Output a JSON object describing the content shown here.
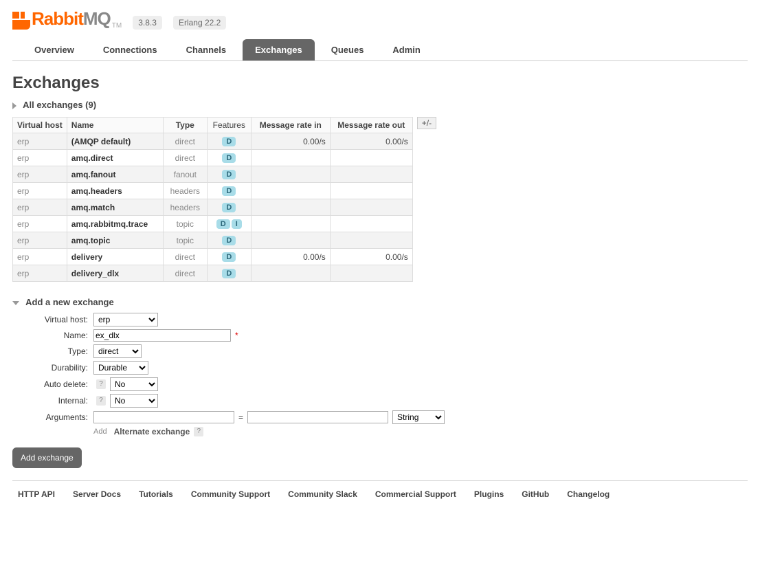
{
  "header": {
    "product_orange": "Rabbit",
    "product_grey": "MQ",
    "tm": "TM",
    "version": "3.8.3",
    "erlang": "Erlang 22.2"
  },
  "tabs": [
    "Overview",
    "Connections",
    "Channels",
    "Exchanges",
    "Queues",
    "Admin"
  ],
  "active_tab": "Exchanges",
  "page_title": "Exchanges",
  "list_section_title": "All exchanges (9)",
  "columns": {
    "vhost": "Virtual host",
    "name": "Name",
    "type": "Type",
    "features": "Features",
    "rate_in": "Message rate in",
    "rate_out": "Message rate out"
  },
  "plus_minus": "+/-",
  "rows": [
    {
      "vhost": "erp",
      "name": "(AMQP default)",
      "type": "direct",
      "features": [
        "D"
      ],
      "rate_in": "0.00/s",
      "rate_out": "0.00/s"
    },
    {
      "vhost": "erp",
      "name": "amq.direct",
      "type": "direct",
      "features": [
        "D"
      ],
      "rate_in": "",
      "rate_out": ""
    },
    {
      "vhost": "erp",
      "name": "amq.fanout",
      "type": "fanout",
      "features": [
        "D"
      ],
      "rate_in": "",
      "rate_out": ""
    },
    {
      "vhost": "erp",
      "name": "amq.headers",
      "type": "headers",
      "features": [
        "D"
      ],
      "rate_in": "",
      "rate_out": ""
    },
    {
      "vhost": "erp",
      "name": "amq.match",
      "type": "headers",
      "features": [
        "D"
      ],
      "rate_in": "",
      "rate_out": ""
    },
    {
      "vhost": "erp",
      "name": "amq.rabbitmq.trace",
      "type": "topic",
      "features": [
        "D",
        "I"
      ],
      "rate_in": "",
      "rate_out": ""
    },
    {
      "vhost": "erp",
      "name": "amq.topic",
      "type": "topic",
      "features": [
        "D"
      ],
      "rate_in": "",
      "rate_out": ""
    },
    {
      "vhost": "erp",
      "name": "delivery",
      "type": "direct",
      "features": [
        "D"
      ],
      "rate_in": "0.00/s",
      "rate_out": "0.00/s"
    },
    {
      "vhost": "erp",
      "name": "delivery_dlx",
      "type": "direct",
      "features": [
        "D"
      ],
      "rate_in": "",
      "rate_out": ""
    }
  ],
  "add_section_title": "Add a new exchange",
  "form": {
    "labels": {
      "vhost": "Virtual host:",
      "name": "Name:",
      "type": "Type:",
      "durability": "Durability:",
      "auto_delete": "Auto delete:",
      "internal": "Internal:",
      "arguments": "Arguments:"
    },
    "vhost_value": "erp",
    "name_value": "ex_dlx",
    "type_value": "direct",
    "durability_value": "Durable",
    "auto_delete_value": "No",
    "internal_value": "No",
    "arg_key": "",
    "arg_val": "",
    "arg_type": "String",
    "equals": "=",
    "add_link": "Add",
    "alt_exchange": "Alternate exchange",
    "help_mark": "?",
    "mandatory": "*",
    "submit": "Add exchange"
  },
  "footer": [
    "HTTP API",
    "Server Docs",
    "Tutorials",
    "Community Support",
    "Community Slack",
    "Commercial Support",
    "Plugins",
    "GitHub",
    "Changelog"
  ]
}
